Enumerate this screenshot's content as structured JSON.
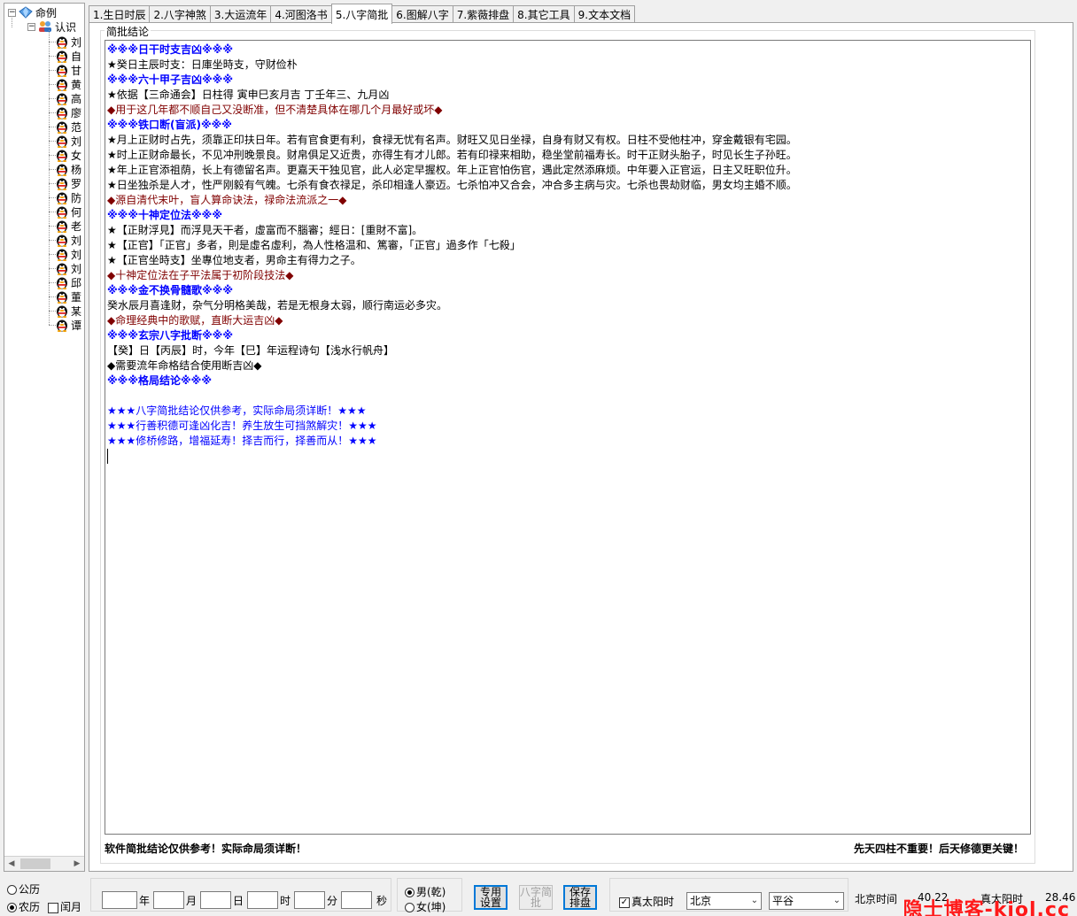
{
  "tree": {
    "root_label": "命例",
    "group_label": "认识",
    "items": [
      "刘",
      "自",
      "甘",
      "黄",
      "高",
      "廖",
      "范",
      "刘",
      "女",
      "杨",
      "罗",
      "防",
      "何",
      "老",
      "刘",
      "刘",
      "刘",
      "邱",
      "董",
      "某",
      "谭"
    ]
  },
  "tabs": [
    {
      "label": "1.生日时辰",
      "active": false
    },
    {
      "label": "2.八字神煞",
      "active": false
    },
    {
      "label": "3.大运流年",
      "active": false
    },
    {
      "label": "4.河图洛书",
      "active": false
    },
    {
      "label": "5.八字简批",
      "active": true
    },
    {
      "label": "6.图解八字",
      "active": false
    },
    {
      "label": "7.紫薇排盘",
      "active": false
    },
    {
      "label": "8.其它工具",
      "active": false
    },
    {
      "label": "9.文本文档",
      "active": false
    }
  ],
  "group_title": "简批结论",
  "lines": [
    {
      "style": "heading",
      "text": "※※※日干时支吉凶※※※"
    },
    {
      "style": "normal",
      "text": "★癸日主辰时支：日庫坐時支，守财俭朴"
    },
    {
      "style": "heading",
      "text": "※※※六十甲子吉凶※※※"
    },
    {
      "style": "normal",
      "text": "★依据【三命通会】日柱得  寅申巳亥月吉  丁壬年三、九月凶"
    },
    {
      "style": "note",
      "text": "◆用于这几年都不顺自己又没断准，但不清楚具体在哪几个月最好或坏◆"
    },
    {
      "style": "heading",
      "text": "※※※铁口断(盲派)※※※"
    },
    {
      "style": "normal",
      "text": "★月上正财时占先，须靠正印扶日年。若有官食更有利，食禄无忧有名声。财旺又见日坐禄，自身有财又有权。日柱不受他柱冲，穿金戴银有宅园。"
    },
    {
      "style": "normal",
      "text": "★时上正财命最长，不见冲刑晚景良。财帛俱足又近贵，亦得生有才儿郎。若有印禄来相助，稳坐堂前福寿长。时干正财头胎子，时见长生子孙旺。"
    },
    {
      "style": "normal",
      "text": "★年上正官添祖荫，长上有德留名声。更嘉天干独见官，此人必定早握权。年上正官怕伤官，遇此定然添麻烦。中年要入正官运，日主又旺职位升。"
    },
    {
      "style": "normal",
      "text": "★日坐独杀是人才，性严刚毅有气魄。七杀有食衣禄足，杀印相逢人豪迈。七杀怕冲又合会，冲合多主病与灾。七杀也畏劫财临，男女均主婚不顺。"
    },
    {
      "style": "note",
      "text": "◆源自清代末叶，盲人算命诀法，禄命法流派之一◆"
    },
    {
      "style": "heading",
      "text": "※※※十神定位法※※※"
    },
    {
      "style": "normal",
      "text": "★【正財浮見】而浮見天干者，虛富而不腦審；經日：[重財不富]。"
    },
    {
      "style": "normal",
      "text": "★【正官】「正官」多者，則是虛名虛利，為人性格温和、篤審，「正官」過多作「七殺」"
    },
    {
      "style": "normal",
      "text": "★【正官坐時支】坐專位地支者，男命主有得力之子。"
    },
    {
      "style": "note",
      "text": "◆十神定位法在子平法属于初阶段技法◆"
    },
    {
      "style": "heading",
      "text": "※※※金不换骨髓歌※※※"
    },
    {
      "style": "normal",
      "text": "癸水辰月喜逢财，杂气分明格美哉，若是无根身太弱，顺行南运必多灾。"
    },
    {
      "style": "note",
      "text": "◆命理经典中的歌赋，直断大运吉凶◆"
    },
    {
      "style": "heading",
      "text": "※※※玄宗八字批断※※※"
    },
    {
      "style": "normal",
      "text": "【癸】日【丙辰】时，今年【巳】年运程诗句【浅水行帆舟】"
    },
    {
      "style": "normal",
      "text": "◆需要流年命格结合使用断吉凶◆"
    },
    {
      "style": "heading",
      "text": "※※※格局结论※※※"
    },
    {
      "style": "blank",
      "text": ""
    },
    {
      "style": "blue",
      "text": "★★★八字简批结论仅供参考，实际命局须详断！★★★"
    },
    {
      "style": "blue",
      "text": "★★★行善积德可逢凶化吉！养生放生可挡煞解灾！★★★"
    },
    {
      "style": "blue",
      "text": "★★★修桥修路，增福延寿！择吉而行，择善而从！★★★"
    }
  ],
  "footer_left": "软件简批结论仅供参考！实际命局须详断！",
  "footer_right": "先天四柱不重要！后天修德更关键！",
  "bottom": {
    "solar_label": "公历",
    "lunar_label": "农历",
    "leap_label": "闰月",
    "year_label": "年",
    "month_label": "月",
    "day_label": "日",
    "hour_label": "时",
    "minute_label": "分",
    "second_label": "秒",
    "male_label": "男(乾)",
    "female_label": "女(坤)",
    "btn_dedicated": "专用设置",
    "btn_bazi": "八字简批",
    "btn_save": "保存排盘",
    "true_solar_label": "真太阳时",
    "city_value": "北京",
    "district_value": "平谷",
    "beijing_time_label": "北京时间",
    "beijing_time_value": "40.22",
    "true_solar_time_label": "真太阳时",
    "true_solar_time_value": "28.46"
  },
  "watermark": "隐士博客-kjol.cc"
}
